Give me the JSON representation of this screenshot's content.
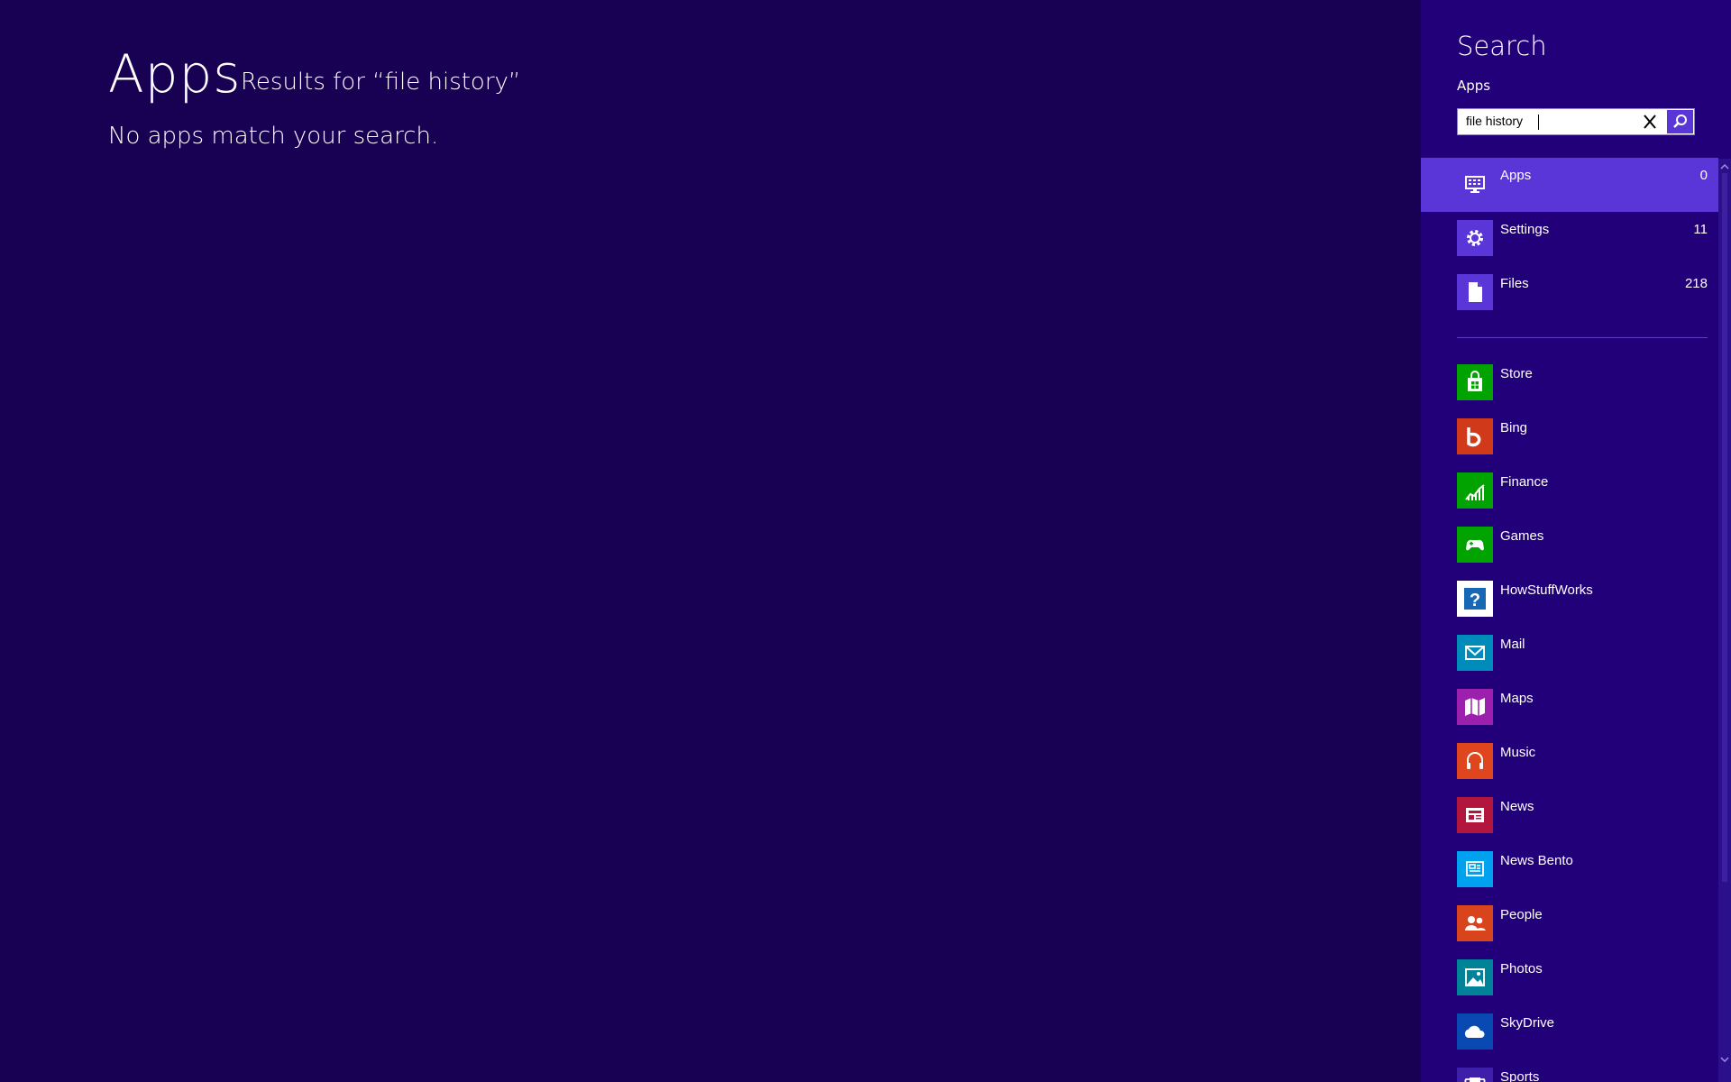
{
  "main": {
    "title": "Apps",
    "results_for": "Results for “file history”",
    "no_results": "No apps match your search."
  },
  "search_pane": {
    "title": "Search",
    "scope": "Apps",
    "query": "file history",
    "clear_icon": "close-icon",
    "search_icon": "magnifier-icon",
    "categories": [
      {
        "label": "Apps",
        "count": "0",
        "icon": "apps-icon",
        "color": "#5a36d8",
        "selected": true
      },
      {
        "label": "Settings",
        "count": "11",
        "icon": "gear-icon",
        "color": "#5a36d8"
      },
      {
        "label": "Files",
        "count": "218",
        "icon": "file-icon",
        "color": "#5a36d8"
      }
    ],
    "apps": [
      {
        "label": "Store",
        "icon": "store-icon",
        "color": "#00a300"
      },
      {
        "label": "Bing",
        "icon": "bing-icon",
        "color": "#d0391a"
      },
      {
        "label": "Finance",
        "icon": "finance-icon",
        "color": "#00a300"
      },
      {
        "label": "Games",
        "icon": "games-icon",
        "color": "#00a300"
      },
      {
        "label": "HowStuffWorks",
        "icon": "howstuffworks-icon",
        "color": "#ffffff"
      },
      {
        "label": "Mail",
        "icon": "mail-icon",
        "color": "#008cba"
      },
      {
        "label": "Maps",
        "icon": "maps-icon",
        "color": "#9c1fad"
      },
      {
        "label": "Music",
        "icon": "music-icon",
        "color": "#e0461d"
      },
      {
        "label": "News",
        "icon": "news-icon",
        "color": "#b3163d"
      },
      {
        "label": "News Bento",
        "icon": "news-bento-icon",
        "color": "#00a2f0"
      },
      {
        "label": "People",
        "icon": "people-icon",
        "color": "#d8441c"
      },
      {
        "label": "Photos",
        "icon": "photos-icon",
        "color": "#008299"
      },
      {
        "label": "SkyDrive",
        "icon": "skydrive-icon",
        "color": "#094ab2"
      },
      {
        "label": "Sports",
        "icon": "sports-icon",
        "color": "#3e1faa"
      }
    ]
  }
}
